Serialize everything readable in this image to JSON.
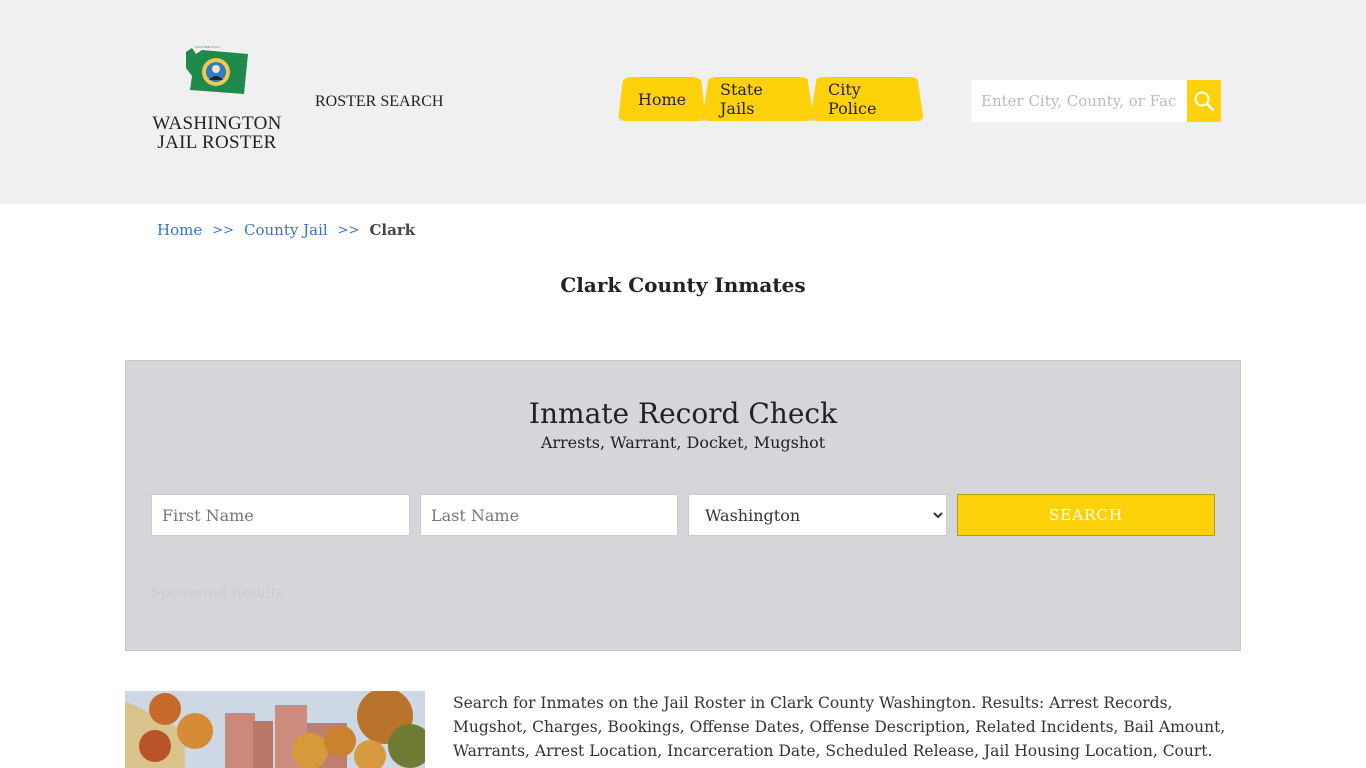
{
  "header": {
    "logo": {
      "line1": "WASHINGTON",
      "line2": "JAIL ROSTER",
      "icon": "washington-state-seal-icon",
      "brand_green": "#1f8a4c"
    },
    "roster_search_label": "ROSTER SEARCH",
    "nav": [
      {
        "label": "Home"
      },
      {
        "label": "State Jails"
      },
      {
        "label": "City Police"
      }
    ],
    "search": {
      "placeholder": "Enter City, County, or Facility",
      "value": "",
      "button_icon": "search-icon"
    },
    "accent_color": "#fdd20a"
  },
  "breadcrumb": {
    "items": [
      {
        "label": "Home"
      },
      {
        "label": "County Jail"
      }
    ],
    "separator": ">>",
    "current": "Clark"
  },
  "page": {
    "title": "Clark County Inmates"
  },
  "record_check": {
    "title": "Inmate Record Check",
    "subtitle": "Arrests, Warrant, Docket, Mugshot",
    "first_name": {
      "placeholder": "First Name",
      "value": ""
    },
    "last_name": {
      "placeholder": "Last Name",
      "value": ""
    },
    "state": {
      "selected": "Washington"
    },
    "submit_label": "SEARCH",
    "sponsored_label": "Sponsored Results"
  },
  "content": {
    "image_alt": "Clark County jail building with autumn trees",
    "description": "Search for Inmates on the Jail Roster in Clark County Washington. Results: Arrest Records, Mugshot, Charges, Bookings, Offense Dates, Offense Description, Related Incidents, Bail Amount, Warrants, Arrest Location, Incarceration Date, Scheduled Release, Jail Housing Location, Court."
  }
}
